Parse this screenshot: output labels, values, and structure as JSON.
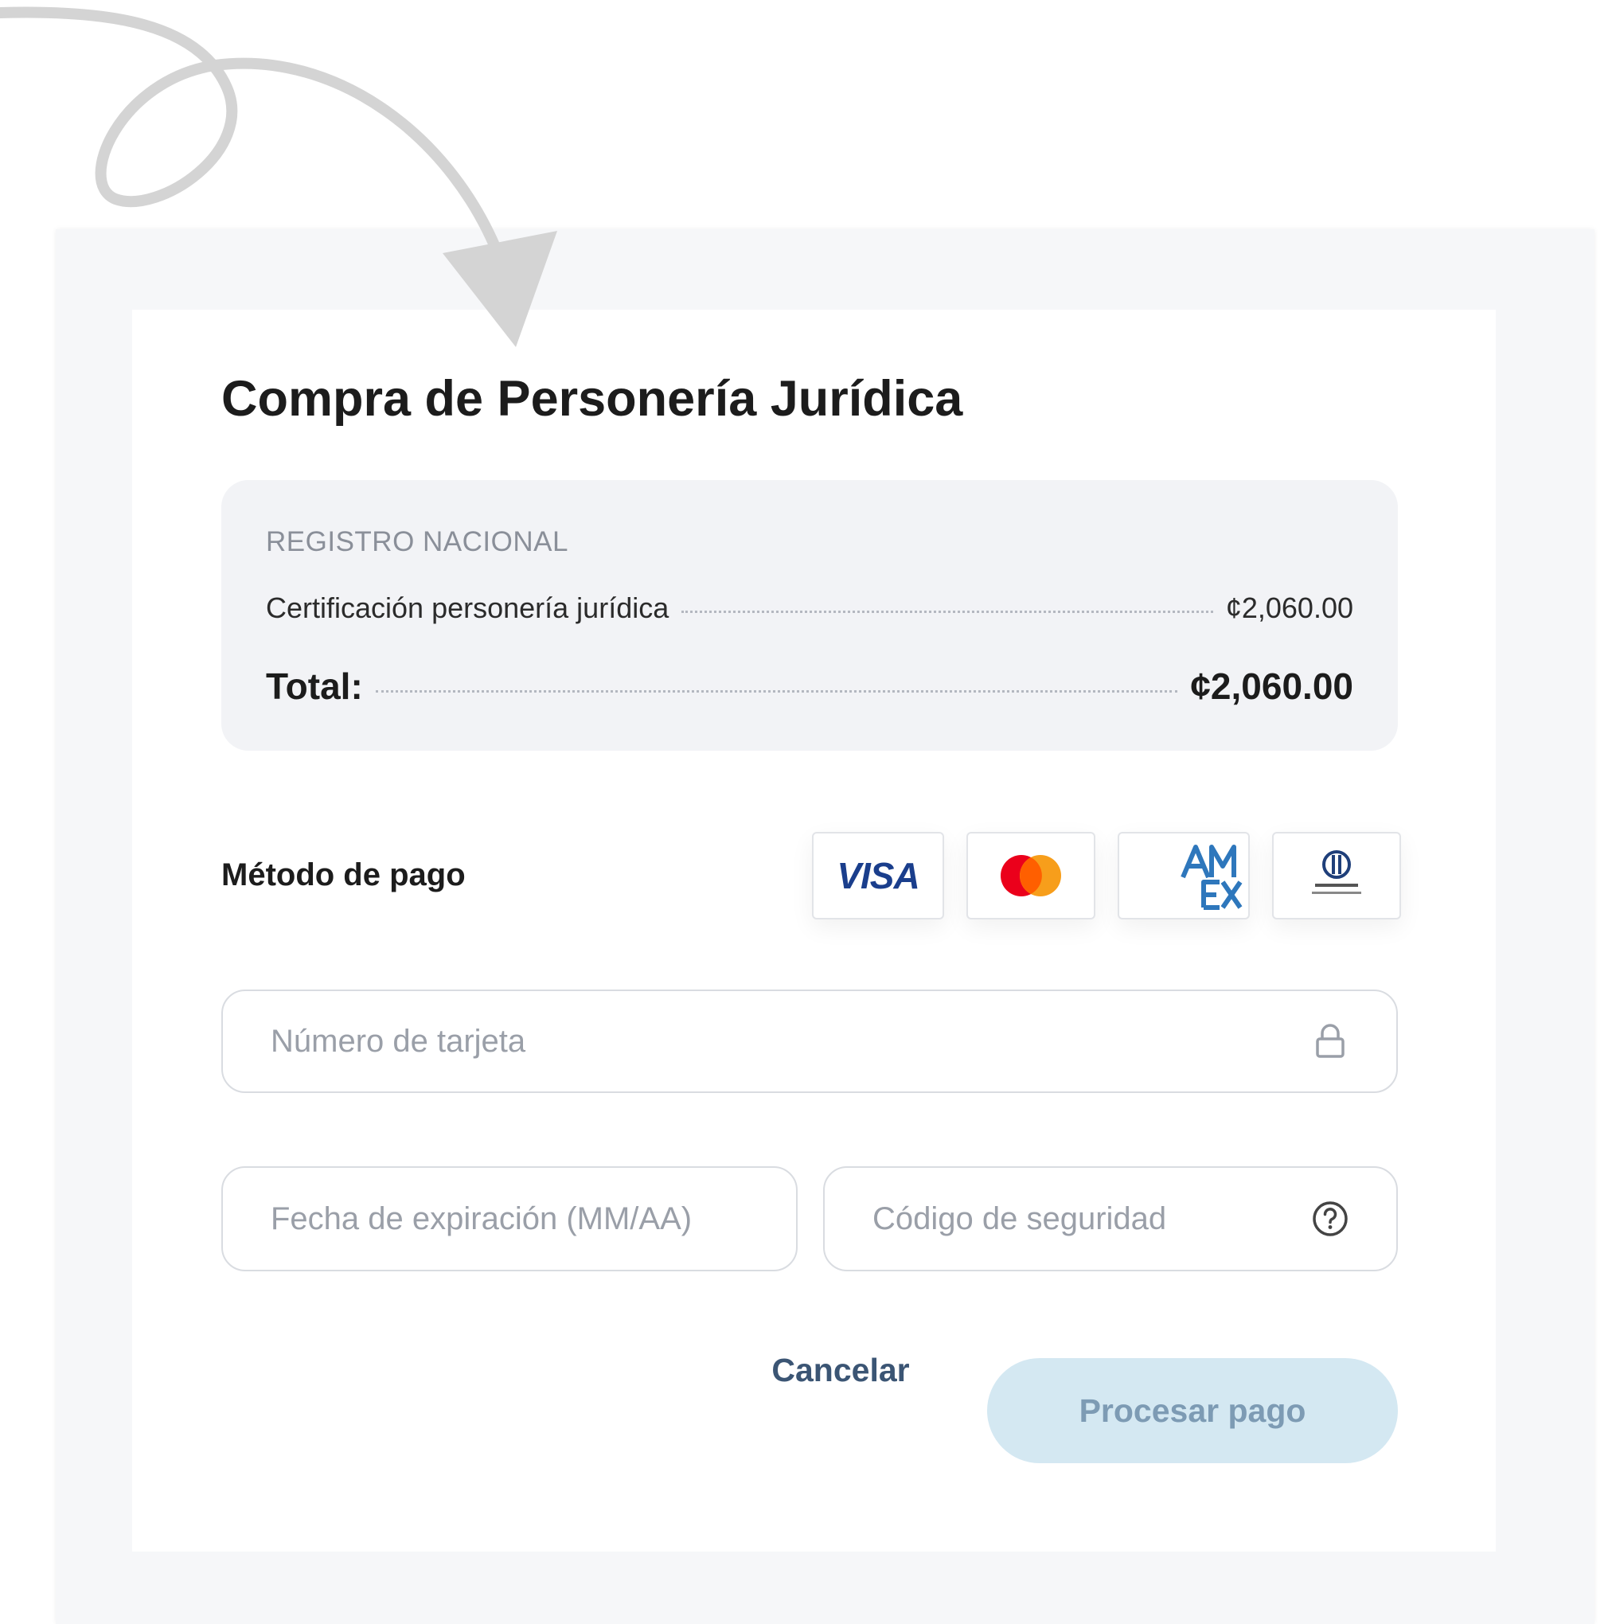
{
  "page": {
    "title": "Compra de Personería Jurídica"
  },
  "summary": {
    "provider": "REGISTRO NACIONAL",
    "items": [
      {
        "label": "Certificación personería jurídica",
        "amount": "¢2,060.00"
      }
    ],
    "total_label": "Total:",
    "total_amount": "¢2,060.00"
  },
  "payment": {
    "label": "Método de pago",
    "accepted_cards": [
      {
        "name": "Visa",
        "icon": "visa-logo",
        "text": "VISA"
      },
      {
        "name": "Mastercard",
        "icon": "mastercard-logo"
      },
      {
        "name": "American Express",
        "icon": "amex-logo"
      },
      {
        "name": "Diners Club International",
        "icon": "diners-club-logo"
      }
    ]
  },
  "form": {
    "card_number": {
      "placeholder": "Número de tarjeta",
      "value": "",
      "icon": "lock-icon"
    },
    "expiry": {
      "placeholder": "Fecha de expiración (MM/AA)",
      "value": ""
    },
    "security_code": {
      "placeholder": "Código de seguridad",
      "value": "",
      "icon": "help-circle-icon"
    }
  },
  "actions": {
    "cancel_label": "Cancelar",
    "submit_label": "Procesar pago"
  },
  "colors": {
    "outer_background": "#f6f7f9",
    "card_background": "#ffffff",
    "summary_background": "#f2f3f6",
    "submit_button_disabled": "#d4e8f2",
    "submit_button_text": "#7d9bb4",
    "cancel_text": "#3b5574",
    "visa_blue": "#1a3e8c",
    "amex_blue": "#2e77bc",
    "mastercard_red": "#eb001b",
    "mastercard_orange": "#f79e1b",
    "decorative_arrow": "#d4d4d4"
  }
}
